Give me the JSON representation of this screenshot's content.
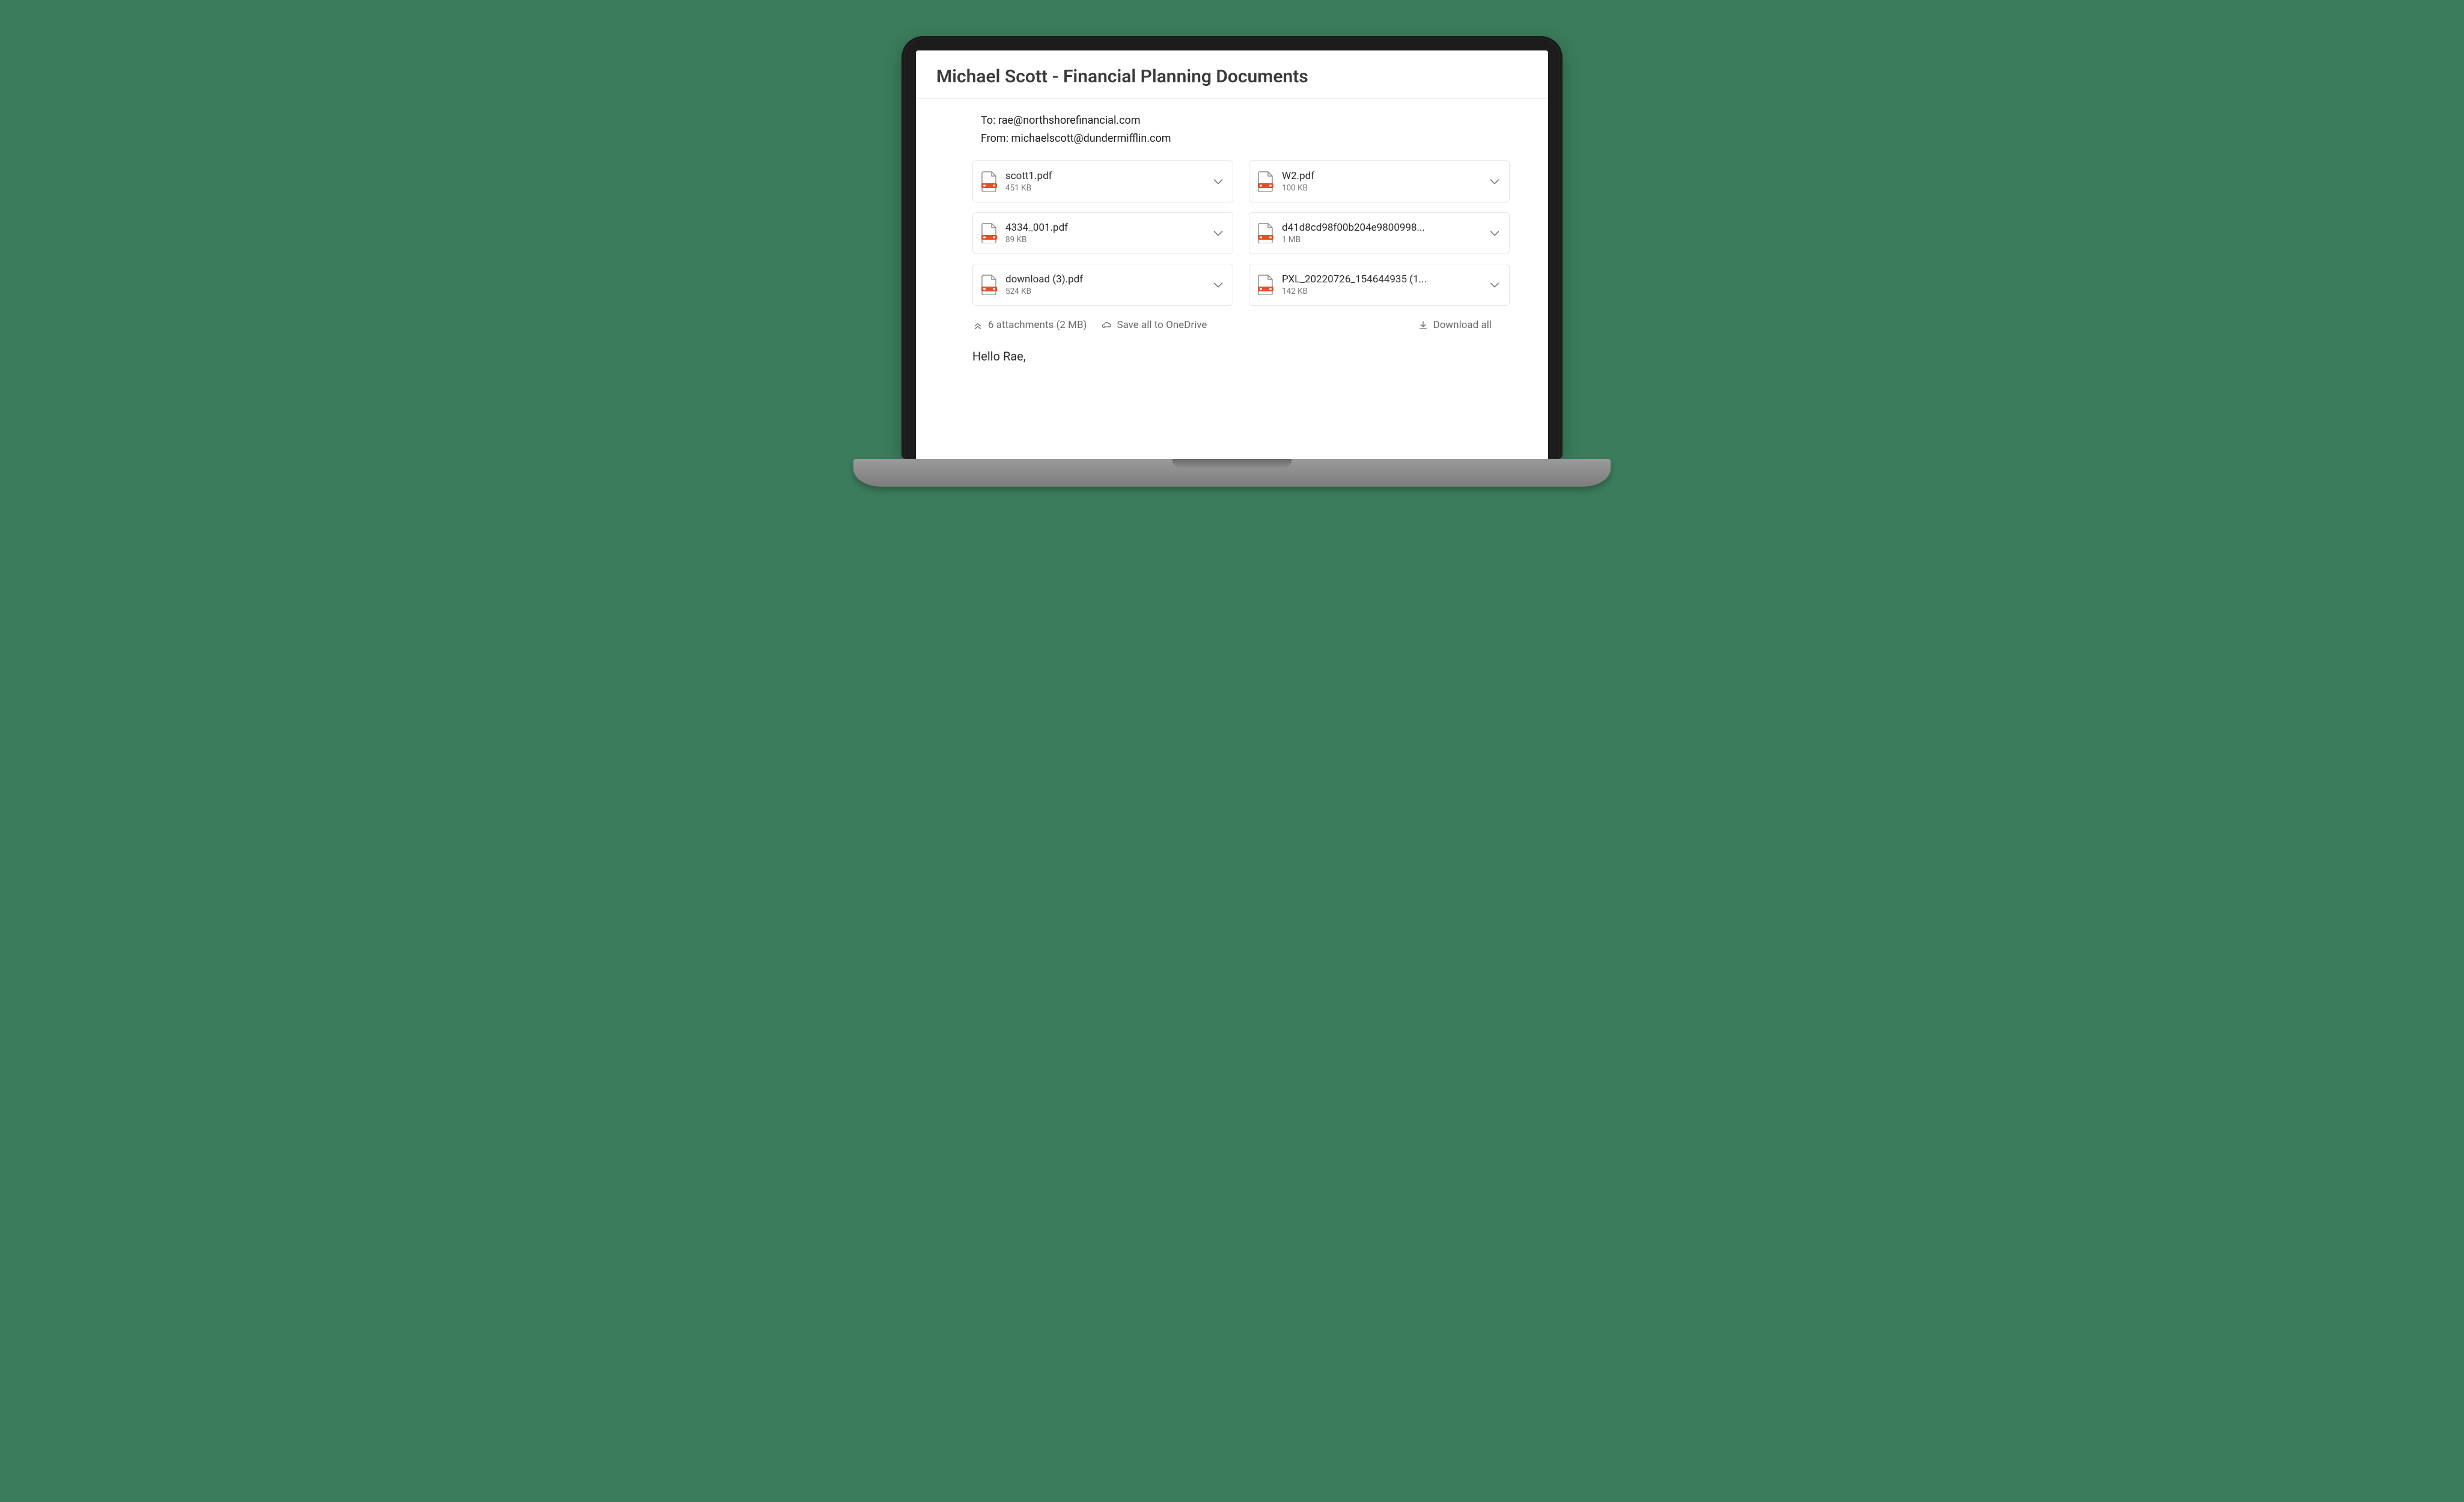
{
  "email": {
    "subject": "Michael Scott - Financial Planning Documents",
    "to_label": "To:",
    "to": "rae@northshorefinancial.com",
    "from_label": "From:",
    "from": "michaelscott@dundermifflin.com",
    "body_greeting": "Hello Rae,"
  },
  "attachments": {
    "items": [
      {
        "name": "scott1.pdf",
        "size": "451 KB"
      },
      {
        "name": "W2.pdf",
        "size": "100 KB"
      },
      {
        "name": "4334_001.pdf",
        "size": "89 KB"
      },
      {
        "name": "d41d8cd98f00b204e9800998...",
        "size": "1 MB"
      },
      {
        "name": "download (3).pdf",
        "size": "524 KB"
      },
      {
        "name": "PXL_20220726_154644935 (1...",
        "size": "142 KB"
      }
    ],
    "summary": "6 attachments (2 MB)",
    "save_all_label": "Save all to OneDrive",
    "download_all_label": "Download all"
  }
}
